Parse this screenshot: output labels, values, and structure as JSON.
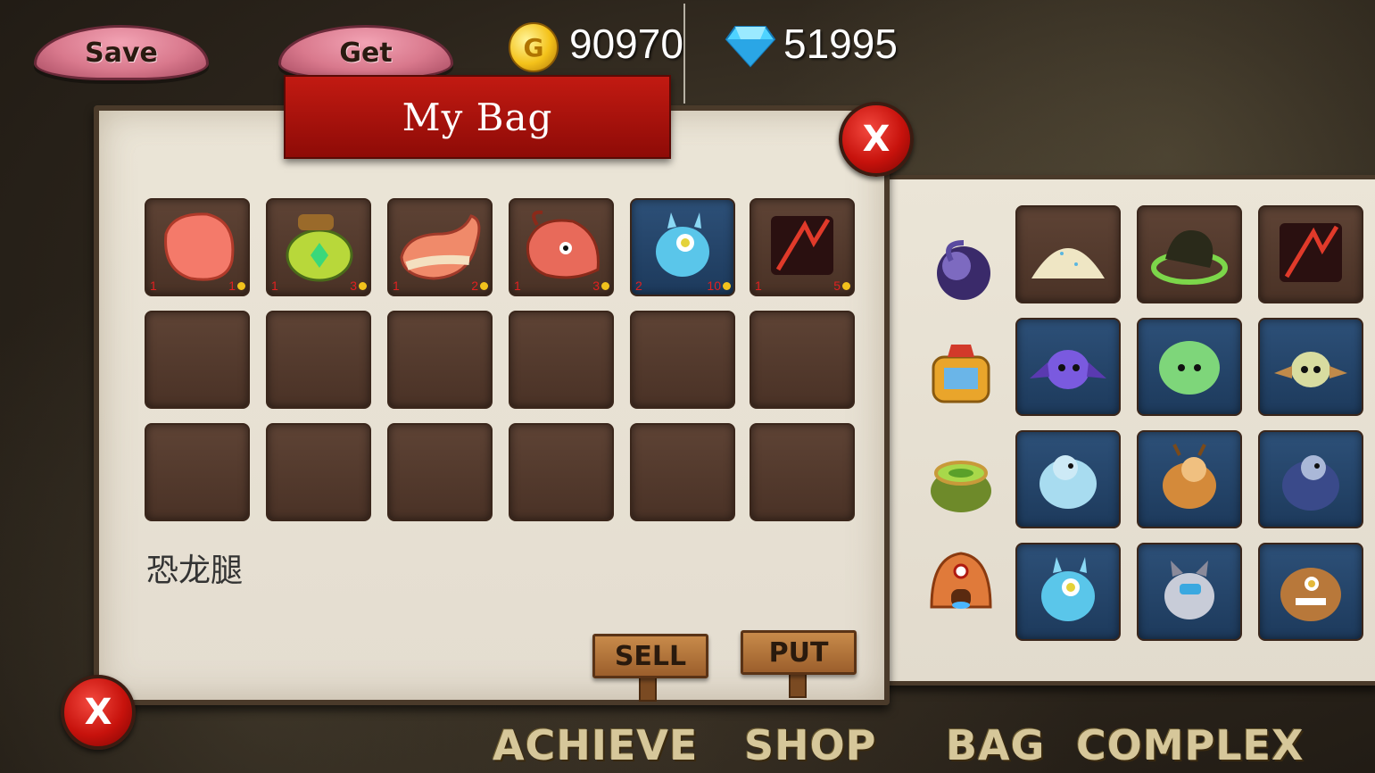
{
  "topbar": {
    "save_label": "Save",
    "get_label": "Get",
    "coins": "90970",
    "gems": "51995"
  },
  "bag": {
    "title": "My Bag",
    "close_label": "X",
    "selected_item_name": "恐龙腿",
    "slots": [
      {
        "item": "meat-icon",
        "qty": "1",
        "price": "1"
      },
      {
        "item": "potion-jar-icon",
        "qty": "1",
        "price": "3"
      },
      {
        "item": "drumstick-icon",
        "qty": "1",
        "price": "2"
      },
      {
        "item": "dragon-head-icon",
        "qty": "1",
        "price": "3"
      },
      {
        "item": "blue-monster-icon",
        "qty": "2",
        "price": "10"
      },
      {
        "item": "dark-claw-icon",
        "qty": "1",
        "price": "5"
      }
    ],
    "sell_label": "SELL",
    "put_label": "PUT"
  },
  "side": {
    "rows": [
      {
        "category_icon": "dark-egg-icon",
        "items": [
          "powder-pile-icon",
          "green-beast-icon",
          "dark-claw-icon"
        ]
      },
      {
        "category_icon": "golden-temple-icon",
        "items": [
          "purple-bat-icon",
          "green-slime-icon",
          "yellow-bat-icon"
        ]
      },
      {
        "category_icon": "green-nest-icon",
        "items": [
          "yeti-icon",
          "brown-beast-icon",
          "dark-yeti-icon"
        ]
      },
      {
        "category_icon": "fire-hut-icon",
        "items": [
          "blue-monster-icon",
          "grey-golem-icon",
          "rock-golem-icon"
        ]
      }
    ]
  },
  "nav": {
    "achieve": "ACHIEVE",
    "shop": "SHOP",
    "bag": "BAG",
    "complex": "COMPLEX",
    "close_label": "X"
  }
}
